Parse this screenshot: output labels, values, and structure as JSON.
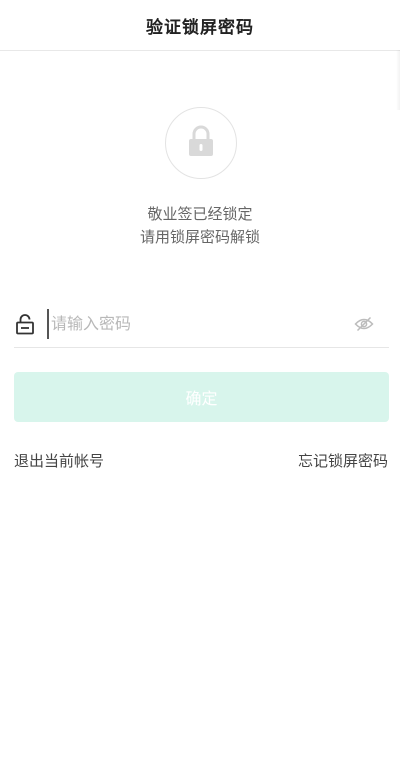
{
  "header": {
    "title": "验证锁屏密码"
  },
  "lock_message": {
    "line1": "敬业签已经锁定",
    "line2": "请用锁屏密码解锁"
  },
  "password_field": {
    "placeholder": "请输入密码",
    "value": "",
    "leading_icon": "lock-icon",
    "trailing_icon": "eye-slash-icon"
  },
  "confirm_button": {
    "label": "确定",
    "background": "#d8f5ec"
  },
  "links": {
    "logout": "退出当前帐号",
    "forgot": "忘记锁屏密码"
  },
  "icons": {
    "hero": "lock-icon"
  }
}
